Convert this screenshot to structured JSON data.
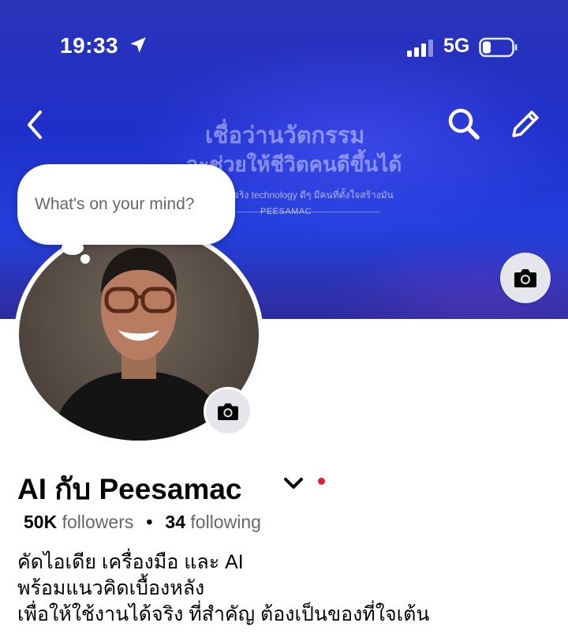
{
  "status_bar": {
    "time": "19:33",
    "network": "5G",
    "icons": [
      "location-arrow-icon",
      "signal-bars-icon",
      "battery-icon"
    ]
  },
  "nav": {
    "icons": [
      "back-chevron-icon",
      "search-icon",
      "pencil-icon"
    ]
  },
  "cover": {
    "headline": "เชื่อว่านวัตกรรม",
    "subheadline": "จะช่วยให้ชีวิตคนดีขึ้นได้",
    "tagline": "จริง technology ดีๆ มีคนที่ตั้งใจสร้างมัน",
    "brand": "PEESAMAC",
    "camera_icon": "camera-icon"
  },
  "avatar": {
    "camera_icon": "camera-icon"
  },
  "thought_bubble": {
    "text": "What's on your mind?"
  },
  "profile": {
    "name": "AI กับ Peesamac",
    "followers_count": "50K",
    "followers_label": "followers",
    "separator": "•",
    "following_count": "34",
    "following_label": "following",
    "bio_lines": [
      "คัดไอเดีย เครื่องมือ และ AI",
      "พร้อมแนวคิดเบื้องหลัง",
      "เพื่อให้ใช้งานได้จริง ที่สำคัญ ต้องเป็นของที่ใจเต้น"
    ]
  },
  "colors": {
    "cover_blue": "#2440e0",
    "accent_red": "#e41e3f",
    "muted_text": "#65676b",
    "button_gray": "#e4e6eb"
  }
}
